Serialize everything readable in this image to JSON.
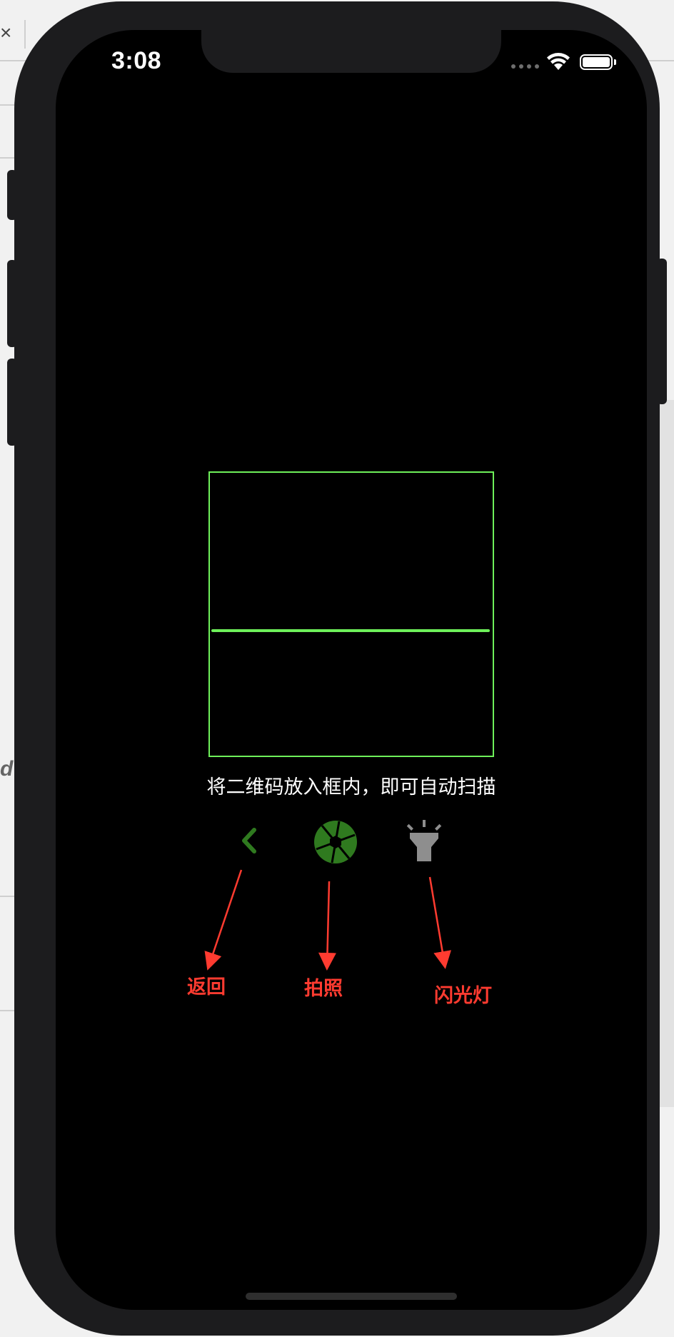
{
  "status_bar": {
    "time": "3:08"
  },
  "scanner": {
    "hint": "将二维码放入框内，即可自动扫描",
    "frame_color": "#6ef05a"
  },
  "controls": {
    "back": {
      "icon": "chevron-left-icon",
      "color": "#2f7a1f"
    },
    "photo": {
      "icon": "camera-aperture-icon",
      "color": "#2f7a1f"
    },
    "flash": {
      "icon": "flashlight-icon",
      "color": "#8e8e8e"
    }
  },
  "annotations": {
    "back_label": "返回",
    "photo_label": "拍照",
    "flash_label": "闪光灯",
    "color": "#ff3b30"
  },
  "background": {
    "close_glyph": "×",
    "fragment": "d"
  }
}
